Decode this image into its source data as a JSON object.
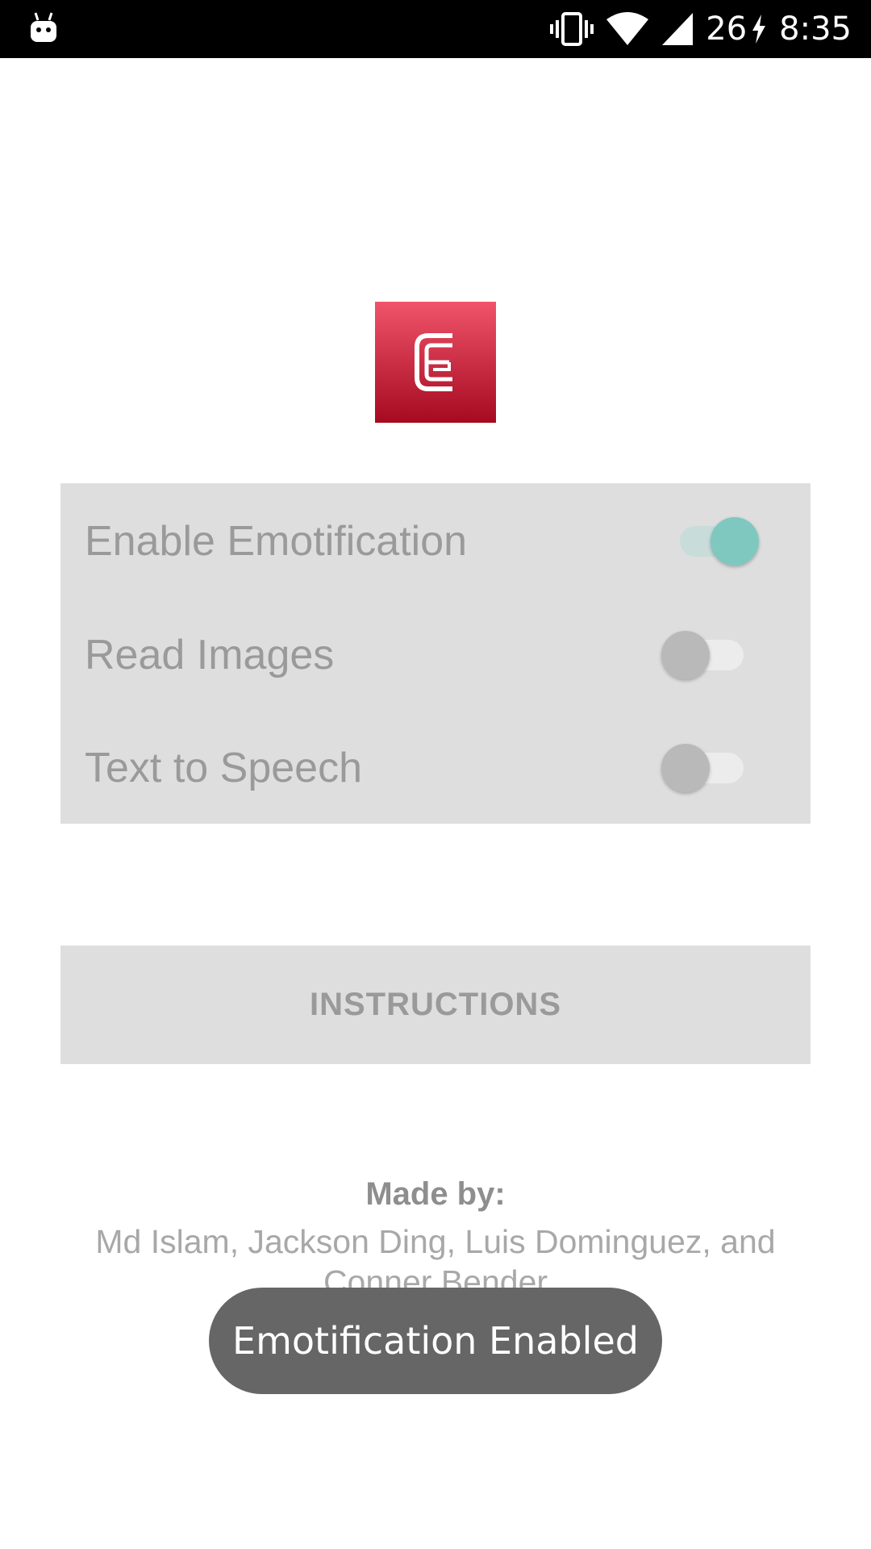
{
  "status_bar": {
    "notification_icon": "android-icon",
    "vibrate_icon": "vibrate-icon",
    "wifi_icon": "wifi-icon",
    "signal_icon": "cellular-signal-icon",
    "battery_level": "26",
    "charging_icon": "charging-bolt-icon",
    "time": "8:35"
  },
  "logo": {
    "icon": "emotification-logo-icon",
    "colors": {
      "top": "#f0546a",
      "bottom": "#a50a20"
    }
  },
  "settings": {
    "items": [
      {
        "label": "Enable Emotification",
        "enabled": true
      },
      {
        "label": "Read Images",
        "enabled": false
      },
      {
        "label": "Text to Speech",
        "enabled": false
      }
    ],
    "accent_color": "#7fc8c0"
  },
  "instructions_button": {
    "label": "INSTRUCTIONS"
  },
  "credits": {
    "title": "Made by:",
    "names": "Md Islam, Jackson Ding, Luis Dominguez, and Conner Bender"
  },
  "toast": {
    "text": "Emotification Enabled"
  }
}
